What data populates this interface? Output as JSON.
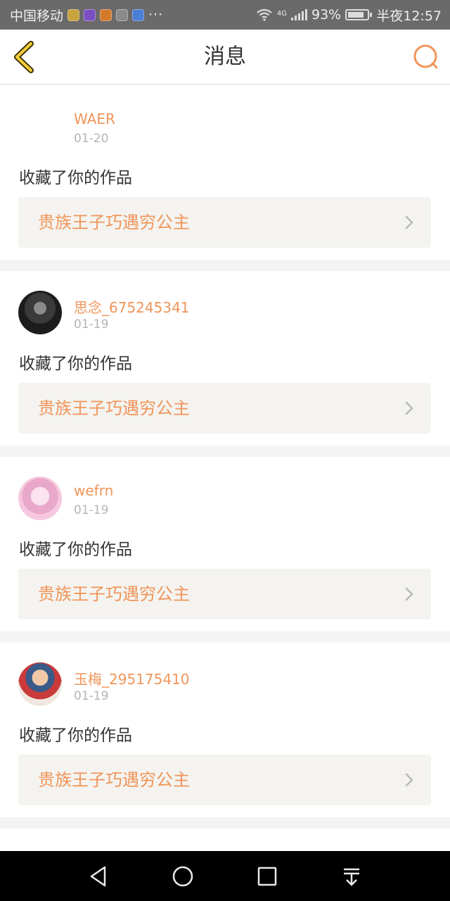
{
  "status_bar": {
    "carrier": "中国移动",
    "app_icons": [
      "#c8a23c",
      "#7a4fc1",
      "#d47a2a",
      "#8a8a8a",
      "#4a7fd6"
    ],
    "more": "···",
    "network": "4G",
    "battery": "93%",
    "time": "半夜12:57"
  },
  "header": {
    "title": "消息",
    "back_icon": "back-chevron-icon",
    "search_icon": "search-icon",
    "accent_color": "#f0955a"
  },
  "notifications": [
    {
      "username": "WAER",
      "date": "01-20",
      "action": "收藏了你的作品",
      "work": "贵族王子巧遇穷公主",
      "avatar": "blank"
    },
    {
      "username": "思念_675245341",
      "date": "01-19",
      "action": "收藏了你的作品",
      "work": "贵族王子巧遇穷公主",
      "avatar": "photo-dark"
    },
    {
      "username": "wefrn",
      "date": "01-19",
      "action": "收藏了你的作品",
      "work": "贵族王子巧遇穷公主",
      "avatar": "anime-pink"
    },
    {
      "username": "玉梅_295175410",
      "date": "01-19",
      "action": "收藏了你的作品",
      "work": "贵族王子巧遇穷公主",
      "avatar": "photo-child"
    }
  ],
  "nav_bar": {
    "buttons": [
      "back-triangle-icon",
      "home-circle-icon",
      "recents-square-icon",
      "notification-pull-icon"
    ]
  }
}
